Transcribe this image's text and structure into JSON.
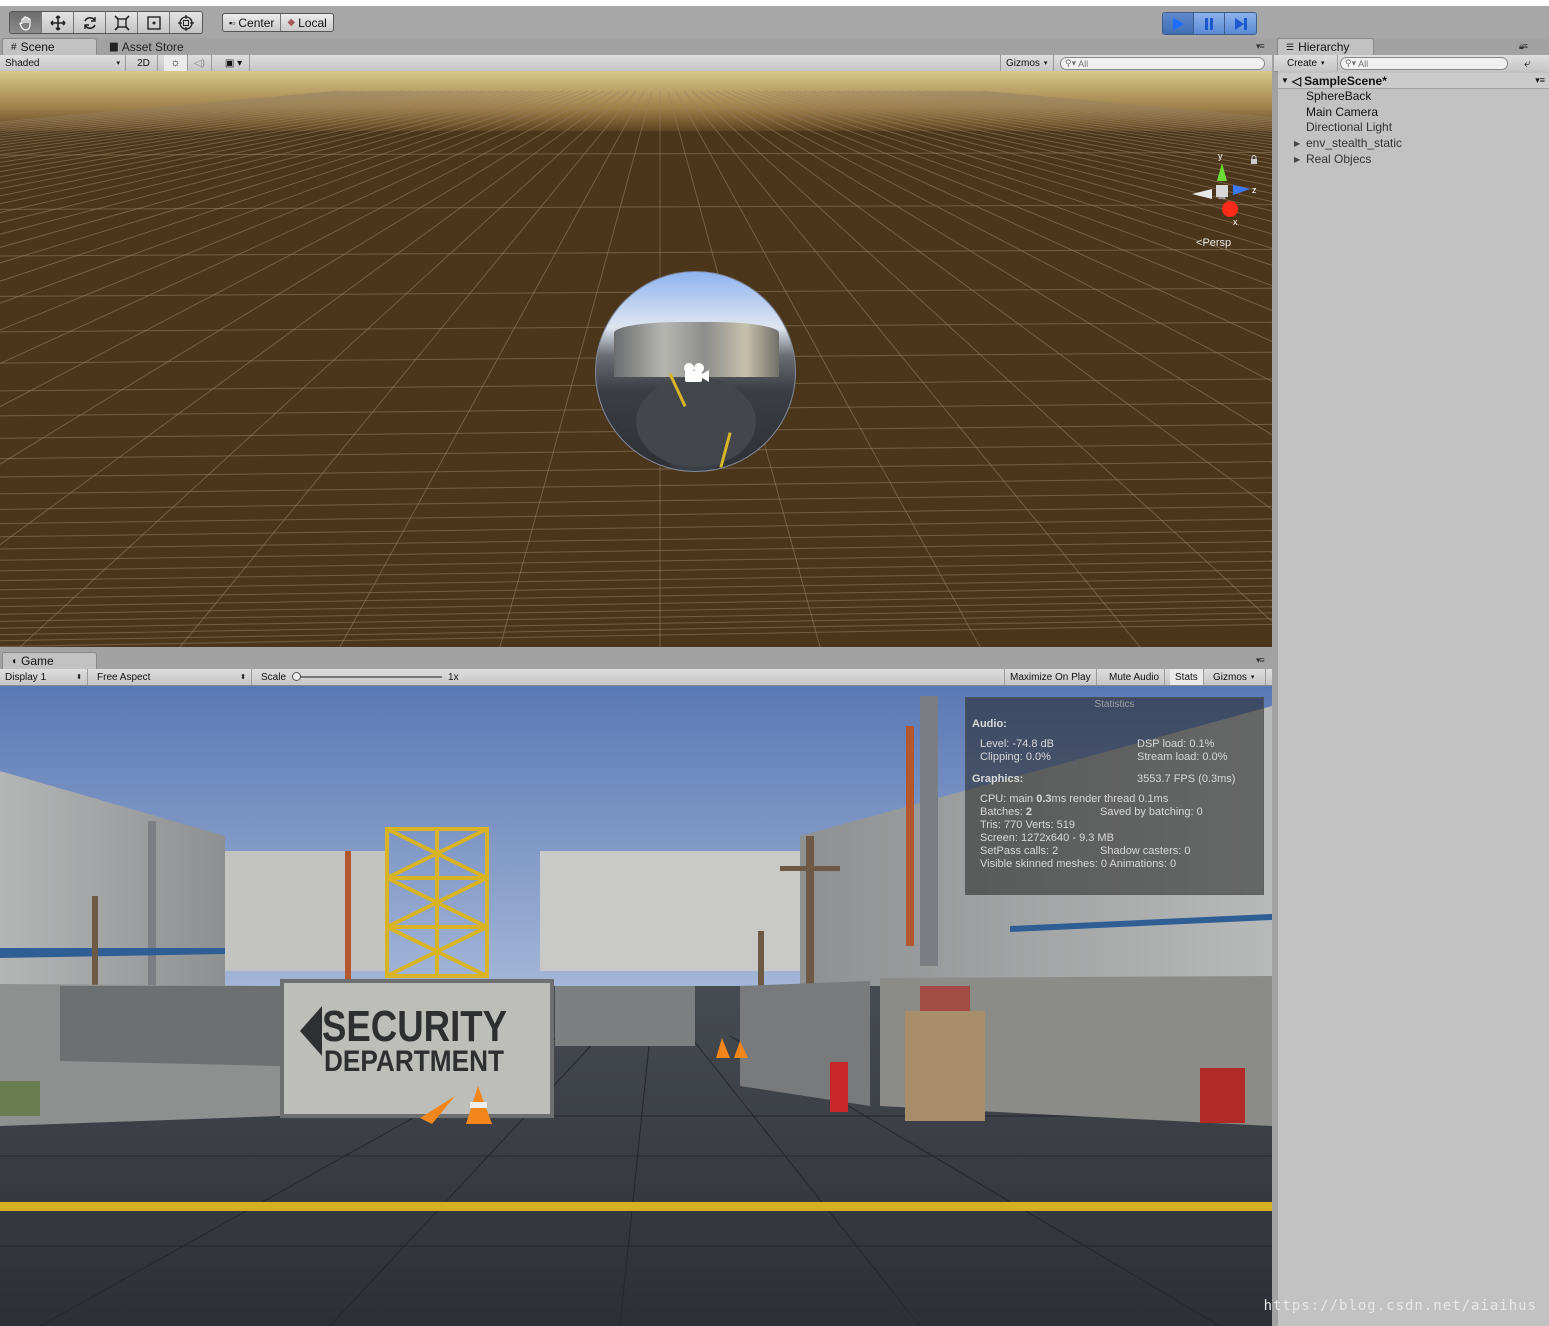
{
  "toolbar": {
    "tools": [
      "hand-tool",
      "move-tool",
      "rotate-tool",
      "scale-tool",
      "rect-tool",
      "transform-tool"
    ],
    "active_tool": "hand-tool",
    "pivot_label": "Center",
    "space_label": "Local",
    "play_controls": [
      "play-icon",
      "pause-icon",
      "step-icon"
    ]
  },
  "scene_panel": {
    "tabs": [
      {
        "label": "Scene",
        "icon": "hash-icon"
      },
      {
        "label": "Asset Store",
        "icon": "store-icon"
      }
    ],
    "draw_mode": "Shaded",
    "btn_2d": "2D",
    "gizmos_label": "Gizmos",
    "search_placeholder": "All",
    "projection_label": "Persp",
    "axis_labels": {
      "y": "y",
      "z": "z",
      "x": "x"
    }
  },
  "game_panel": {
    "tab_label": "Game",
    "display": "Display 1",
    "aspect": "Free Aspect",
    "scale_label": "Scale",
    "scale_value": "1x",
    "maximize_label": "Maximize On Play",
    "mute_label": "Mute Audio",
    "stats_label": "Stats",
    "gizmos_label": "Gizmos",
    "sign_line1": "SECURITY",
    "sign_line2": "DEPARTMENT"
  },
  "stats": {
    "title": "Statistics",
    "audio_heading": "Audio:",
    "level": "Level: -74.8 dB",
    "dsp": "DSP load: 0.1%",
    "clipping": "Clipping: 0.0%",
    "stream": "Stream load: 0.0%",
    "graphics_heading": "Graphics:",
    "fps": "3553.7 FPS (0.3ms)",
    "cpu_prefix": "CPU: main",
    "cpu_main": "0.3",
    "cpu_suffix": "ms  render thread 0.1ms",
    "batches_prefix": "Batches:",
    "batches_value": "2",
    "saved_batching": "Saved by batching: 0",
    "tris": "Tris: 770  Verts: 519",
    "screen": "Screen: 1272x640 - 9.3 MB",
    "setpass": "SetPass calls: 2",
    "shadow_casters": "Shadow casters: 0",
    "skinned": "Visible skinned meshes: 0  Animations: 0"
  },
  "hierarchy": {
    "tab_label": "Hierarchy",
    "create_label": "Create",
    "search_placeholder": "All",
    "scene_name": "SampleScene*",
    "items": [
      {
        "label": "SphereBack",
        "expandable": false
      },
      {
        "label": "Main Camera",
        "expandable": false
      },
      {
        "label": "Directional Light",
        "expandable": false
      },
      {
        "label": "env_stealth_static",
        "expandable": true
      },
      {
        "label": "Real Objecs",
        "expandable": true
      }
    ]
  },
  "watermark": "https://blog.csdn.net/aiaihus",
  "colors": {
    "scene_ground": "#4c361b",
    "sky": "#6d8ecf",
    "road_line": "#d6b021",
    "play_active": "#5f89c9"
  }
}
